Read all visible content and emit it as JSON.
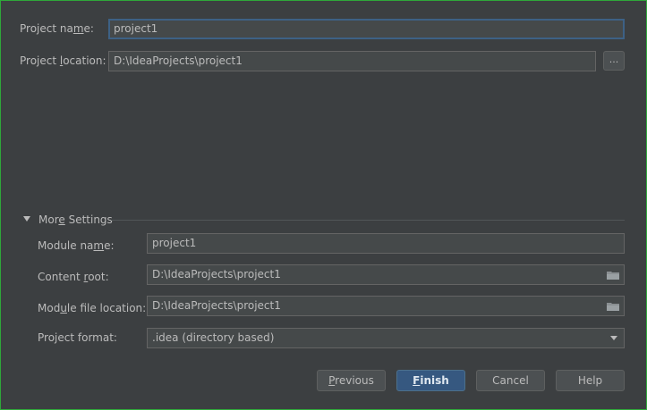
{
  "project": {
    "name_label_pre": "Project na",
    "name_label_mn": "m",
    "name_label_post": "e:",
    "name_value": "project1",
    "location_label_pre": "Project ",
    "location_label_mn": "l",
    "location_label_post": "ocation:",
    "location_value": "D:\\IdeaProjects\\project1",
    "browse_label": "..."
  },
  "more_settings": {
    "title_pre": "Mor",
    "title_mn": "e",
    "title_post": " Settings",
    "module_name_label_pre": "Module na",
    "module_name_label_mn": "m",
    "module_name_label_post": "e:",
    "module_name_value": "project1",
    "content_root_label_pre": "Content ",
    "content_root_label_mn": "r",
    "content_root_label_post": "oot:",
    "content_root_value": "D:\\IdeaProjects\\project1",
    "module_file_label_pre": "Mod",
    "module_file_label_mn": "u",
    "module_file_label_post": "le file location:",
    "module_file_value": "D:\\IdeaProjects\\project1",
    "format_label": "Project format:",
    "format_value": ".idea (directory based)"
  },
  "buttons": {
    "previous_mn": "P",
    "previous_rest": "revious",
    "finish_mn": "F",
    "finish_rest": "inish",
    "cancel": "Cancel",
    "help": "Help"
  },
  "colors": {
    "background": "#3c3f41",
    "field": "#45494a",
    "focus_border": "#3d6185",
    "default_button": "#365880",
    "window_border": "#2fa83a"
  }
}
